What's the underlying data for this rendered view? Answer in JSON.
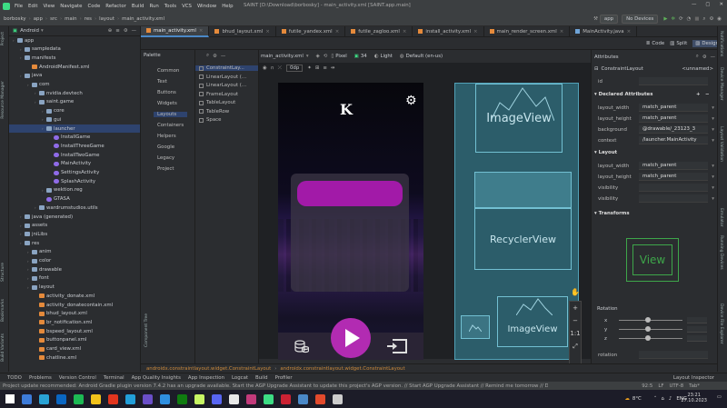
{
  "window": {
    "title": "SAINT [D:\\Download\\borbosky] - main_activity.xml [SAINT.app.main]",
    "controls": [
      "—",
      "▢",
      "✕"
    ]
  },
  "menu": [
    "File",
    "Edit",
    "View",
    "Navigate",
    "Code",
    "Refactor",
    "Build",
    "Run",
    "Tools",
    "VCS",
    "Window",
    "Help"
  ],
  "toolbar": {
    "breadcrumbs": [
      "borbosky",
      "app",
      "src",
      "main",
      "res",
      "layout",
      "main_activity.xml"
    ],
    "run_config": "app",
    "device": "No Devices"
  },
  "project": {
    "view_mode": "Android",
    "items": [
      {
        "label": "app",
        "depth": 0,
        "type": "fold"
      },
      {
        "label": "sampledata",
        "depth": 1,
        "type": "fold"
      },
      {
        "label": "manifests",
        "depth": 1,
        "type": "fold"
      },
      {
        "label": "AndroidManifest.xml",
        "depth": 2,
        "type": "xml"
      },
      {
        "label": "java",
        "depth": 1,
        "type": "fold"
      },
      {
        "label": "com",
        "depth": 2,
        "type": "fold"
      },
      {
        "label": "nvidia.devtech",
        "depth": 3,
        "type": "fold"
      },
      {
        "label": "saint.game",
        "depth": 3,
        "type": "fold"
      },
      {
        "label": "core",
        "depth": 4,
        "type": "fold"
      },
      {
        "label": "gui",
        "depth": 4,
        "type": "fold"
      },
      {
        "label": "launcher",
        "depth": 4,
        "type": "fold",
        "selected": true
      },
      {
        "label": "InstallGame",
        "depth": 5,
        "type": "kt"
      },
      {
        "label": "InstallThreeGame",
        "depth": 5,
        "type": "kt"
      },
      {
        "label": "InstallTwoGame",
        "depth": 5,
        "type": "kt"
      },
      {
        "label": "MainActivity",
        "depth": 5,
        "type": "kt"
      },
      {
        "label": "SettingsActivity",
        "depth": 5,
        "type": "kt"
      },
      {
        "label": "SplashActivity",
        "depth": 5,
        "type": "kt"
      },
      {
        "label": "wektion.reg",
        "depth": 4,
        "type": "fold"
      },
      {
        "label": "GTASA",
        "depth": 4,
        "type": "kt"
      },
      {
        "label": "wardrumstudios.utils",
        "depth": 3,
        "type": "fold"
      },
      {
        "label": "java (generated)",
        "depth": 1,
        "type": "fold"
      },
      {
        "label": "assets",
        "depth": 1,
        "type": "fold"
      },
      {
        "label": "jniLibs",
        "depth": 1,
        "type": "fold"
      },
      {
        "label": "res",
        "depth": 1,
        "type": "fold"
      },
      {
        "label": "anim",
        "depth": 2,
        "type": "fold"
      },
      {
        "label": "color",
        "depth": 2,
        "type": "fold"
      },
      {
        "label": "drawable",
        "depth": 2,
        "type": "fold"
      },
      {
        "label": "font",
        "depth": 2,
        "type": "fold"
      },
      {
        "label": "layout",
        "depth": 2,
        "type": "fold"
      },
      {
        "label": "activity_donate.xml",
        "depth": 3,
        "type": "xml"
      },
      {
        "label": "activity_donatecontain.xml",
        "depth": 3,
        "type": "xml"
      },
      {
        "label": "bhud_layout.xml",
        "depth": 3,
        "type": "xml"
      },
      {
        "label": "br_notification.xml",
        "depth": 3,
        "type": "xml"
      },
      {
        "label": "bspeed_layout.xml",
        "depth": 3,
        "type": "xml"
      },
      {
        "label": "buttonpanel.xml",
        "depth": 3,
        "type": "xml"
      },
      {
        "label": "card_view.xml",
        "depth": 3,
        "type": "xml"
      },
      {
        "label": "chatline.xml",
        "depth": 3,
        "type": "xml"
      }
    ]
  },
  "tabs": [
    {
      "label": "main_activity.xml",
      "active": true
    },
    {
      "label": "bhud_layout.xml"
    },
    {
      "label": "futile_yandex.xml"
    },
    {
      "label": "futile_zagloo.xml"
    },
    {
      "label": "install_activity.xml"
    },
    {
      "label": "main_render_screen.xml"
    },
    {
      "label": "MainActivity.java"
    }
  ],
  "view_modes": [
    "Code",
    "Split",
    "Design"
  ],
  "palette": {
    "title": "Palette",
    "categories": [
      "Common",
      "Text",
      "Buttons",
      "Widgets",
      "Layouts",
      "Containers",
      "Helpers",
      "Google",
      "Legacy",
      "Project"
    ],
    "active_category": "Layouts",
    "items": [
      "ConstraintLay...",
      "LinearLayout (...",
      "LinearLayout (...",
      "FrameLayout",
      "TableLayout",
      "TableRow",
      "Space"
    ]
  },
  "design": {
    "file": "main_activity.xml",
    "device": "Pixel",
    "api": "34",
    "theme": "Light",
    "locale": "Default (en-us)",
    "dp": "0dp",
    "logo": "K",
    "blueprint": {
      "top": "ImageView",
      "middle": "RecyclerView",
      "bottom": "ImageView"
    }
  },
  "attributes": {
    "title": "Attributes",
    "component": "ConstraintLayout",
    "component_name": "<unnamed>",
    "id_label": "id",
    "declared_header": "Declared Attributes",
    "declared": [
      {
        "k": "layout_width",
        "v": "match_parent"
      },
      {
        "k": "layout_height",
        "v": "match_parent"
      },
      {
        "k": "background",
        "v": "@drawable/_23123_3"
      },
      {
        "k": "context",
        "v": "/launcher.MainActivity"
      }
    ],
    "layout_header": "Layout",
    "layout": [
      {
        "k": "layout_width",
        "v": "match_parent"
      },
      {
        "k": "layout_height",
        "v": "match_parent"
      },
      {
        "k": "visibility",
        "v": ""
      },
      {
        "k": "visibility",
        "v": ""
      }
    ],
    "transforms_header": "Transforms",
    "preview_label": "View",
    "rotation_label": "Rotation",
    "axes": [
      "x",
      "y",
      "z"
    ],
    "rotation_field": "rotation"
  },
  "component_tree_label": "Component Tree",
  "path_bar": [
    "androidx.constraintlayout.widget.ConstraintLayout",
    "androidx.constraintlayout.widget.ConstraintLayout"
  ],
  "bottom_tools": [
    "TODO",
    "Problems",
    "Version Control",
    "Terminal",
    "App Quality Insights",
    "App Inspection",
    "Logcat",
    "Build",
    "Profiler",
    "Layout Inspector"
  ],
  "status": {
    "message": "Project update recommended: Android Gradle plugin version 7.4.2 has an upgrade available. Start the AGP Upgrade Assistant to update this project's AGP version. // Start AGP Upgrade Assistant // Remind me tomorrow // Don't ask for this p... (today 19:51)",
    "position": "92:5",
    "line_sep": "LF",
    "encoding": "UTF-8",
    "indent": "Tab*"
  },
  "left_tools": [
    "Project",
    "Resource Manager",
    "Structure",
    "Bookmarks",
    "Build Variants"
  ],
  "right_tools": [
    "Notifications",
    "Device Manager",
    "Layout Validation",
    "Emulator",
    "Running Devices",
    "Device File Explorer"
  ],
  "taskbar": {
    "weather": "8°C",
    "lang": "ENG",
    "time": "23:21",
    "date": "27.10.2023",
    "icons": [
      "#ffffff",
      "#3d7bd9",
      "#2aa3d6",
      "#0a66c2",
      "#1db954",
      "#f2c21b",
      "#e2351e",
      "#229ed9",
      "#6a4ec8",
      "#2f8fe0",
      "#107c10",
      "#c7f464",
      "#5865f2",
      "#e8e8e8",
      "#c33a7b",
      "#3ddc84",
      "#cc2233",
      "#4a88c7",
      "#e34a2c",
      "#cccccc"
    ]
  }
}
